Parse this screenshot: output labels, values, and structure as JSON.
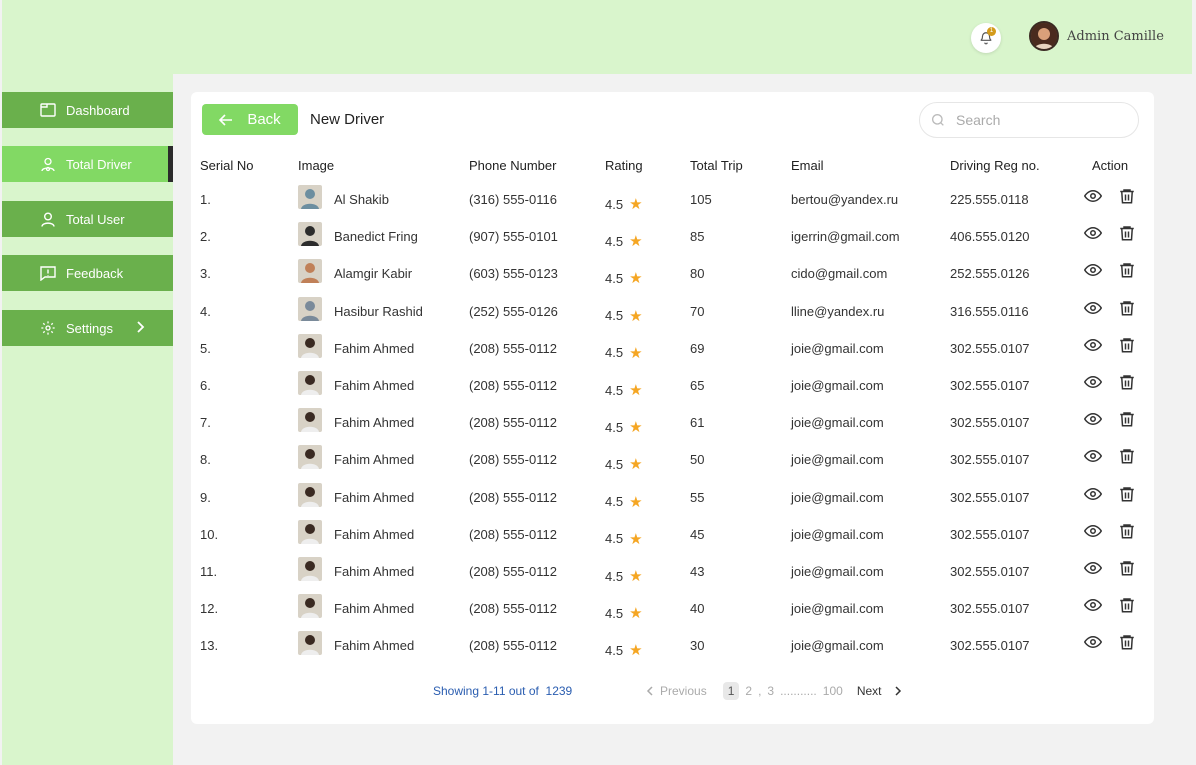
{
  "header": {
    "notification_count": "1",
    "admin_name": "Admin Camille"
  },
  "sidebar": {
    "items": [
      {
        "label": "Dashboard",
        "icon": "dashboard-icon"
      },
      {
        "label": "Total Driver",
        "icon": "driver-icon",
        "active": true
      },
      {
        "label": "Total User",
        "icon": "user-icon"
      },
      {
        "label": "Feedback",
        "icon": "feedback-icon"
      },
      {
        "label": "Settings",
        "icon": "gear-icon"
      }
    ]
  },
  "toolbar": {
    "back_label": "Back",
    "title": "New Driver",
    "search_placeholder": "Search"
  },
  "table": {
    "columns": [
      "Serial No",
      "Image",
      "Phone Number",
      "Rating",
      "Total Trip",
      "Email",
      "Driving Reg no.",
      "Action"
    ],
    "rows": [
      {
        "serial": "1.",
        "name": "Al Shakib",
        "phone": "(316) 555-0116",
        "rating": "4.5",
        "trips": "105",
        "email": "bertou@yandex.ru",
        "reg": "225.555.0118"
      },
      {
        "serial": "2.",
        "name": "Banedict Fring",
        "phone": "(907) 555-0101",
        "rating": "4.5",
        "trips": "85",
        "email": "igerrin@gmail.com",
        "reg": "406.555.0120"
      },
      {
        "serial": "3.",
        "name": "Alamgir Kabir",
        "phone": "(603) 555-0123",
        "rating": "4.5",
        "trips": "80",
        "email": "cido@gmail.com",
        "reg": "252.555.0126"
      },
      {
        "serial": "4.",
        "name": "Hasibur Rashid",
        "phone": "(252) 555-0126",
        "rating": "4.5",
        "trips": "70",
        "email": "lline@yandex.ru",
        "reg": "316.555.0116"
      },
      {
        "serial": "5.",
        "name": "Fahim Ahmed",
        "phone": "(208) 555-0112",
        "rating": "4.5",
        "trips": "69",
        "email": "joie@gmail.com",
        "reg": "302.555.0107"
      },
      {
        "serial": "6.",
        "name": "Fahim Ahmed",
        "phone": "(208) 555-0112",
        "rating": "4.5",
        "trips": "65",
        "email": "joie@gmail.com",
        "reg": "302.555.0107"
      },
      {
        "serial": "7.",
        "name": "Fahim Ahmed",
        "phone": "(208) 555-0112",
        "rating": "4.5",
        "trips": "61",
        "email": "joie@gmail.com",
        "reg": "302.555.0107"
      },
      {
        "serial": "8.",
        "name": "Fahim Ahmed",
        "phone": "(208) 555-0112",
        "rating": "4.5",
        "trips": "50",
        "email": "joie@gmail.com",
        "reg": "302.555.0107"
      },
      {
        "serial": "9.",
        "name": "Fahim Ahmed",
        "phone": "(208) 555-0112",
        "rating": "4.5",
        "trips": "55",
        "email": "joie@gmail.com",
        "reg": "302.555.0107"
      },
      {
        "serial": "10.",
        "name": "Fahim Ahmed",
        "phone": "(208) 555-0112",
        "rating": "4.5",
        "trips": "45",
        "email": "joie@gmail.com",
        "reg": "302.555.0107"
      },
      {
        "serial": "11.",
        "name": "Fahim Ahmed",
        "phone": "(208) 555-0112",
        "rating": "4.5",
        "trips": "43",
        "email": "joie@gmail.com",
        "reg": "302.555.0107"
      },
      {
        "serial": "12.",
        "name": "Fahim Ahmed",
        "phone": "(208) 555-0112",
        "rating": "4.5",
        "trips": "40",
        "email": "joie@gmail.com",
        "reg": "302.555.0107"
      },
      {
        "serial": "13.",
        "name": "Fahim Ahmed",
        "phone": "(208) 555-0112",
        "rating": "4.5",
        "trips": "30",
        "email": "joie@gmail.com",
        "reg": "302.555.0107"
      }
    ]
  },
  "pagination": {
    "showing_text": "Showing 1-11 out of",
    "total": "1239",
    "previous_label": "Previous",
    "pages": [
      "1",
      "2",
      "3"
    ],
    "ellipsis": "...........",
    "last_page": "100",
    "next_label": "Next"
  },
  "colors": {
    "topbar_bg": "#d9f5cc",
    "nav_bg": "#6ab04c",
    "nav_active": "#82d964",
    "accent": "#82d964",
    "star": "#f5a623",
    "link": "#2a5db0"
  }
}
